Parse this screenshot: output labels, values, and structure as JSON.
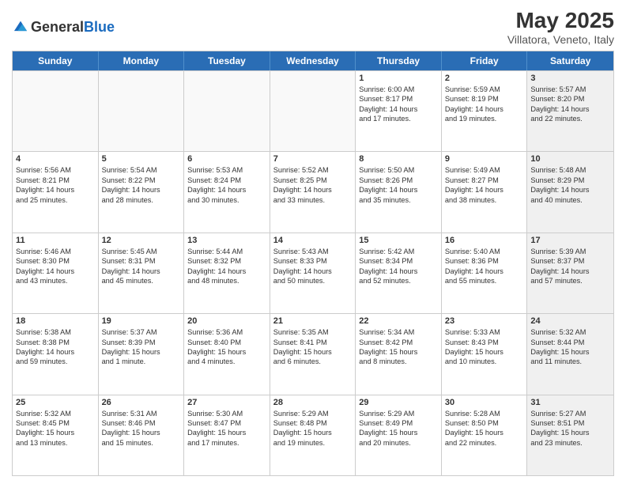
{
  "logo": {
    "general": "General",
    "blue": "Blue"
  },
  "title": "May 2025",
  "subtitle": "Villatora, Veneto, Italy",
  "days": [
    "Sunday",
    "Monday",
    "Tuesday",
    "Wednesday",
    "Thursday",
    "Friday",
    "Saturday"
  ],
  "weeks": [
    [
      {
        "day": "",
        "lines": [],
        "empty": true
      },
      {
        "day": "",
        "lines": [],
        "empty": true
      },
      {
        "day": "",
        "lines": [],
        "empty": true
      },
      {
        "day": "",
        "lines": [],
        "empty": true
      },
      {
        "day": "1",
        "lines": [
          "Sunrise: 6:00 AM",
          "Sunset: 8:17 PM",
          "Daylight: 14 hours",
          "and 17 minutes."
        ]
      },
      {
        "day": "2",
        "lines": [
          "Sunrise: 5:59 AM",
          "Sunset: 8:19 PM",
          "Daylight: 14 hours",
          "and 19 minutes."
        ]
      },
      {
        "day": "3",
        "lines": [
          "Sunrise: 5:57 AM",
          "Sunset: 8:20 PM",
          "Daylight: 14 hours",
          "and 22 minutes."
        ],
        "shaded": true
      }
    ],
    [
      {
        "day": "4",
        "lines": [
          "Sunrise: 5:56 AM",
          "Sunset: 8:21 PM",
          "Daylight: 14 hours",
          "and 25 minutes."
        ]
      },
      {
        "day": "5",
        "lines": [
          "Sunrise: 5:54 AM",
          "Sunset: 8:22 PM",
          "Daylight: 14 hours",
          "and 28 minutes."
        ]
      },
      {
        "day": "6",
        "lines": [
          "Sunrise: 5:53 AM",
          "Sunset: 8:24 PM",
          "Daylight: 14 hours",
          "and 30 minutes."
        ]
      },
      {
        "day": "7",
        "lines": [
          "Sunrise: 5:52 AM",
          "Sunset: 8:25 PM",
          "Daylight: 14 hours",
          "and 33 minutes."
        ]
      },
      {
        "day": "8",
        "lines": [
          "Sunrise: 5:50 AM",
          "Sunset: 8:26 PM",
          "Daylight: 14 hours",
          "and 35 minutes."
        ]
      },
      {
        "day": "9",
        "lines": [
          "Sunrise: 5:49 AM",
          "Sunset: 8:27 PM",
          "Daylight: 14 hours",
          "and 38 minutes."
        ]
      },
      {
        "day": "10",
        "lines": [
          "Sunrise: 5:48 AM",
          "Sunset: 8:29 PM",
          "Daylight: 14 hours",
          "and 40 minutes."
        ],
        "shaded": true
      }
    ],
    [
      {
        "day": "11",
        "lines": [
          "Sunrise: 5:46 AM",
          "Sunset: 8:30 PM",
          "Daylight: 14 hours",
          "and 43 minutes."
        ]
      },
      {
        "day": "12",
        "lines": [
          "Sunrise: 5:45 AM",
          "Sunset: 8:31 PM",
          "Daylight: 14 hours",
          "and 45 minutes."
        ]
      },
      {
        "day": "13",
        "lines": [
          "Sunrise: 5:44 AM",
          "Sunset: 8:32 PM",
          "Daylight: 14 hours",
          "and 48 minutes."
        ]
      },
      {
        "day": "14",
        "lines": [
          "Sunrise: 5:43 AM",
          "Sunset: 8:33 PM",
          "Daylight: 14 hours",
          "and 50 minutes."
        ]
      },
      {
        "day": "15",
        "lines": [
          "Sunrise: 5:42 AM",
          "Sunset: 8:34 PM",
          "Daylight: 14 hours",
          "and 52 minutes."
        ]
      },
      {
        "day": "16",
        "lines": [
          "Sunrise: 5:40 AM",
          "Sunset: 8:36 PM",
          "Daylight: 14 hours",
          "and 55 minutes."
        ]
      },
      {
        "day": "17",
        "lines": [
          "Sunrise: 5:39 AM",
          "Sunset: 8:37 PM",
          "Daylight: 14 hours",
          "and 57 minutes."
        ],
        "shaded": true
      }
    ],
    [
      {
        "day": "18",
        "lines": [
          "Sunrise: 5:38 AM",
          "Sunset: 8:38 PM",
          "Daylight: 14 hours",
          "and 59 minutes."
        ]
      },
      {
        "day": "19",
        "lines": [
          "Sunrise: 5:37 AM",
          "Sunset: 8:39 PM",
          "Daylight: 15 hours",
          "and 1 minute."
        ]
      },
      {
        "day": "20",
        "lines": [
          "Sunrise: 5:36 AM",
          "Sunset: 8:40 PM",
          "Daylight: 15 hours",
          "and 4 minutes."
        ]
      },
      {
        "day": "21",
        "lines": [
          "Sunrise: 5:35 AM",
          "Sunset: 8:41 PM",
          "Daylight: 15 hours",
          "and 6 minutes."
        ]
      },
      {
        "day": "22",
        "lines": [
          "Sunrise: 5:34 AM",
          "Sunset: 8:42 PM",
          "Daylight: 15 hours",
          "and 8 minutes."
        ]
      },
      {
        "day": "23",
        "lines": [
          "Sunrise: 5:33 AM",
          "Sunset: 8:43 PM",
          "Daylight: 15 hours",
          "and 10 minutes."
        ]
      },
      {
        "day": "24",
        "lines": [
          "Sunrise: 5:32 AM",
          "Sunset: 8:44 PM",
          "Daylight: 15 hours",
          "and 11 minutes."
        ],
        "shaded": true
      }
    ],
    [
      {
        "day": "25",
        "lines": [
          "Sunrise: 5:32 AM",
          "Sunset: 8:45 PM",
          "Daylight: 15 hours",
          "and 13 minutes."
        ]
      },
      {
        "day": "26",
        "lines": [
          "Sunrise: 5:31 AM",
          "Sunset: 8:46 PM",
          "Daylight: 15 hours",
          "and 15 minutes."
        ]
      },
      {
        "day": "27",
        "lines": [
          "Sunrise: 5:30 AM",
          "Sunset: 8:47 PM",
          "Daylight: 15 hours",
          "and 17 minutes."
        ]
      },
      {
        "day": "28",
        "lines": [
          "Sunrise: 5:29 AM",
          "Sunset: 8:48 PM",
          "Daylight: 15 hours",
          "and 19 minutes."
        ]
      },
      {
        "day": "29",
        "lines": [
          "Sunrise: 5:29 AM",
          "Sunset: 8:49 PM",
          "Daylight: 15 hours",
          "and 20 minutes."
        ]
      },
      {
        "day": "30",
        "lines": [
          "Sunrise: 5:28 AM",
          "Sunset: 8:50 PM",
          "Daylight: 15 hours",
          "and 22 minutes."
        ]
      },
      {
        "day": "31",
        "lines": [
          "Sunrise: 5:27 AM",
          "Sunset: 8:51 PM",
          "Daylight: 15 hours",
          "and 23 minutes."
        ],
        "shaded": true
      }
    ]
  ]
}
